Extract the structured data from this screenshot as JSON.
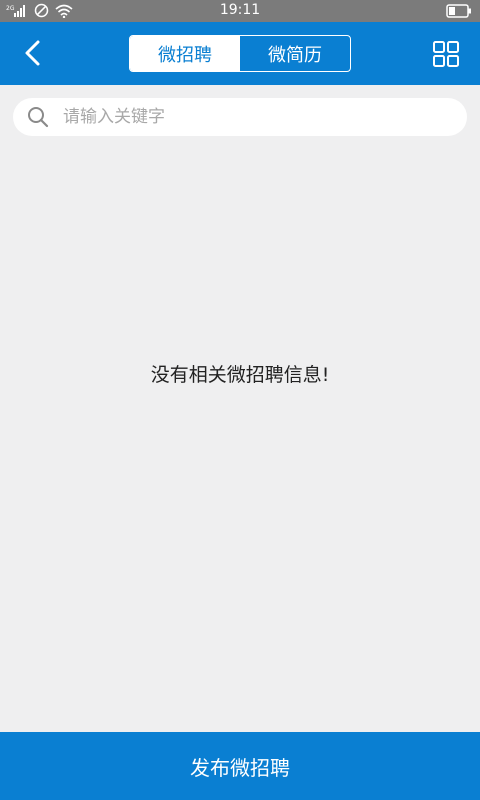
{
  "statusbar": {
    "time": "19:11",
    "network_label": "2G",
    "icons": [
      "signal-icon",
      "do-not-disturb-icon",
      "wifi-icon",
      "battery-icon"
    ]
  },
  "navbar": {
    "background_color": "#0a7fd2",
    "back_icon": "chevron-left-icon",
    "tabs": [
      {
        "label": "微招聘",
        "active": true
      },
      {
        "label": "微简历",
        "active": false
      }
    ],
    "menu_icon": "grid-icon"
  },
  "search": {
    "placeholder": "请输入关键字",
    "value": "",
    "icon": "search-icon"
  },
  "main": {
    "empty_message": "没有相关微招聘信息!"
  },
  "footer": {
    "publish_label": "发布微招聘"
  }
}
